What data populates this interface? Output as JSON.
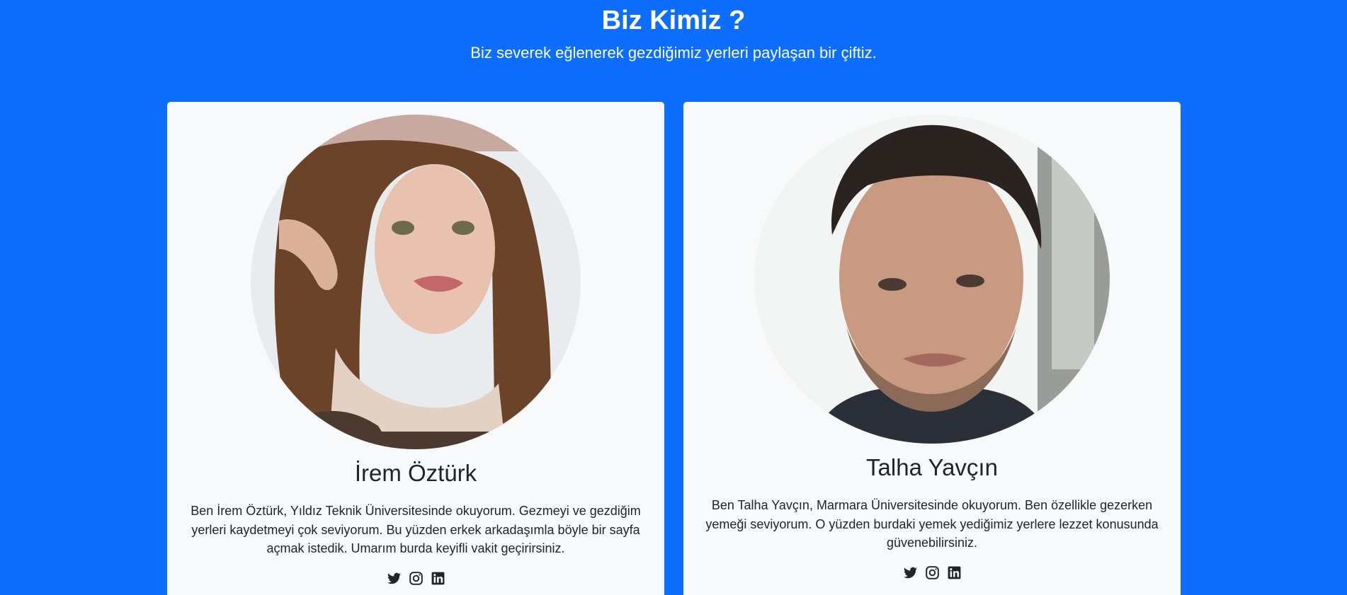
{
  "about": {
    "title": "Biz Kimiz ?",
    "subtitle": "Biz severek eğlenerek gezdiğimiz yerleri paylaşan bir çiftiz."
  },
  "members": [
    {
      "name": "İrem Öztürk",
      "bio": "Ben İrem Öztürk, Yıldız Teknik Üniversitesinde okuyorum. Gezmeyi ve gezdiğim yerleri kaydetmeyi çok seviyorum. Bu yüzden erkek arkadaşımla böyle bir sayfa açmak istedik. Umarım burda keyifli vakit geçirirsiniz.",
      "socials": [
        "twitter-icon",
        "instagram-icon",
        "linkedin-icon"
      ]
    },
    {
      "name": "Talha Yavçın",
      "bio": "Ben Talha Yavçın, Marmara Üniversitesinde okuyorum. Ben özellikle gezerken yemeği seviyorum. O yüzden burdaki yemek yediğimiz yerlere lezzet konusunda güvenebilirsiniz.",
      "socials": [
        "twitter-icon",
        "instagram-icon",
        "linkedin-icon"
      ]
    }
  ],
  "colors": {
    "background": "#0d6efd",
    "card": "#f8f9fa",
    "text": "#212529"
  }
}
